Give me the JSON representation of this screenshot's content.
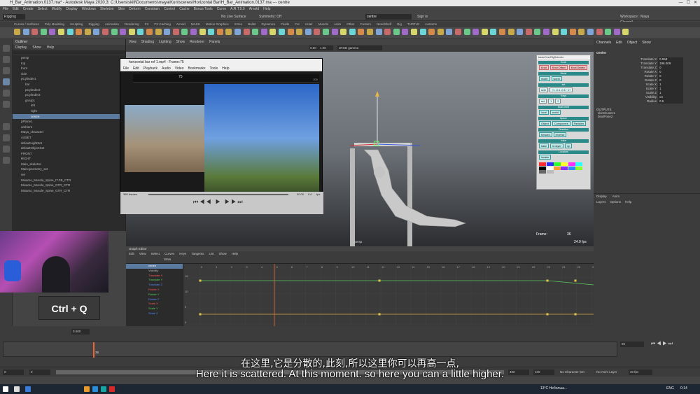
{
  "window": {
    "title": "H_Bar_Animation.0137.ma* - Autodesk Maya 2020.3: C:\\Users\\skill\\Documents\\maya\\Kun\\scenes\\Horizontal Bar\\H_Bar_Animation.0137.ma --- centre"
  },
  "menubar": [
    "File",
    "Edit",
    "Create",
    "Select",
    "Modify",
    "Display",
    "Windows",
    "Skeleton",
    "Skin",
    "Deform",
    "Constrain",
    "Control",
    "Cache",
    "Bonus Tools",
    "Curve",
    "A.R.T.5.0",
    "Arnold",
    "Help"
  ],
  "statusline": {
    "mode": "Rigging",
    "search": "centre",
    "no_live_surface": "No Live Surface",
    "symmetry": "Symmetry: Off",
    "sign_in": "Sign in",
    "workspace": "Workspace : Maya Classic*"
  },
  "shelf_tabs": [
    "Curves / Surfaces",
    "Poly Modeling",
    "Sculpting",
    "Rigging",
    "Animation",
    "Rendering",
    "FX",
    "FX Caching",
    "Arnold",
    "MASH",
    "Motion Graphics",
    "XGen",
    "Bullet",
    "Dynamics",
    "Fluids",
    "Fur",
    "nHair",
    "Muscle",
    "Anim",
    "Other",
    "Custom",
    "NeedShelf",
    "Rig",
    "TURTLE",
    "customs"
  ],
  "outliner": {
    "title": "Outliner",
    "menu": [
      "Display",
      "Show",
      "Help"
    ],
    "items": [
      {
        "label": "persp",
        "sel": false
      },
      {
        "label": "top",
        "sel": false
      },
      {
        "label": "front",
        "sel": false
      },
      {
        "label": "side",
        "sel": false
      },
      {
        "label": "pCylinder1",
        "sel": false
      },
      {
        "label": "bar",
        "sel": false
      },
      {
        "label": "pCylinder2",
        "sel": false
      },
      {
        "label": "pCylinder3",
        "sel": false
      },
      {
        "label": "group1",
        "sel": false
      },
      {
        "label": "left",
        "sel": false
      },
      {
        "label": "right",
        "sel": false
      },
      {
        "label": "centre",
        "sel": true
      },
      {
        "label": "pPlane1",
        "sel": false
      },
      {
        "label": "ambient",
        "sel": false
      },
      {
        "label": "Maya_character",
        "sel": false
      },
      {
        "label": "ASSET",
        "sel": false
      },
      {
        "label": "defaultLightSet",
        "sel": false
      },
      {
        "label": "defaultObjectSet",
        "sel": false
      },
      {
        "label": "FRONT",
        "sel": false
      },
      {
        "label": "RIGHT",
        "sel": false
      },
      {
        "label": "Main_skeleton",
        "sel": false
      },
      {
        "label": "Main:geometry_set",
        "sel": false
      },
      {
        "label": "set",
        "sel": false
      },
      {
        "label": "Mixamo_Muscle_Spine_IT.FB_CTR",
        "sel": false
      },
      {
        "label": "Mixamo_Muscle_Spine_GTR_CTR",
        "sel": false
      },
      {
        "label": "Mixamo_Muscle_Spine_GTR_CTR",
        "sel": false
      }
    ]
  },
  "viewport": {
    "menu": [
      "View",
      "Shading",
      "Lighting",
      "Show",
      "Renderer",
      "Panels"
    ],
    "color_space": "sRGB gamma",
    "field1": "0.00",
    "field2": "1.00",
    "camera_label": "persp",
    "frame_label": "Frame:",
    "frame_value": "36",
    "fps_value": "24.0 fps"
  },
  "hud": {
    "title": "basicOverRigSelectio",
    "sections": [
      {
        "head": "Knob",
        "buttons": [
          {
            "t": "Knot",
            "c": "red"
          },
          {
            "t": "Knot Offset",
            "c": "red"
          },
          {
            "t": "Knot Delete",
            "c": "red"
          }
        ]
      },
      {
        "head": "Mode",
        "buttons": [
          {
            "t": "mode",
            "c": "teal"
          },
          {
            "t": "world",
            "c": "teal"
          }
        ]
      },
      {
        "head": "set",
        "buttons": [
          {
            "t": "sete",
            "c": "cyan"
          },
          {
            "t": "+1 -0.1 -0.1+ 1+",
            "c": "cyan"
          }
        ]
      },
      {
        "head": "Keys",
        "buttons": [
          {
            "t": "set",
            "c": "cyan"
          },
          {
            "t": "1",
            "c": "cyan"
          },
          {
            "t": "2",
            "c": "cyan"
          }
        ]
      },
      {
        "head": "local world",
        "buttons": [
          {
            "t": "local",
            "c": "teal"
          },
          {
            "t": "world",
            "c": "teal"
          }
        ]
      },
      {
        "head": "Space",
        "buttons": [
          {
            "t": "Object",
            "c": "teal"
          },
          {
            "t": "Component",
            "c": "teal"
          },
          {
            "t": "Particles",
            "c": "teal"
          }
        ]
      },
      {
        "head": "Direction",
        "buttons": [
          {
            "t": "forward",
            "c": "teal"
          },
          {
            "t": "reverse",
            "c": "teal"
          }
        ]
      },
      {
        "head": "bake",
        "buttons": [
          {
            "t": "bake",
            "c": "teal"
          },
          {
            "t": "to layer",
            "c": "teal"
          },
          {
            "t": "np",
            "c": "teal"
          }
        ]
      },
      {
        "head": "Locators",
        "buttons": [
          {
            "t": "locator",
            "c": "teal"
          }
        ]
      }
    ],
    "swatches": [
      "#ff2d2d",
      "#2d2dff",
      "#2dff2d",
      "#ffff2d",
      "#ff2dff",
      "#2dffff",
      "#000000",
      "#ffffff",
      "#ff9a2d",
      "#8a2dff",
      "#2d8aff",
      "#8aff2d",
      "#666666",
      "#bbbbbb"
    ]
  },
  "video_player": {
    "title": "horizontal bar ref 1.mp4 - Frame:75",
    "menu": [
      "File",
      "Edit",
      "Playback",
      "Audio",
      "Video",
      "Bookmarks",
      "Tools",
      "Help"
    ],
    "ruler_frame": "75",
    "ruler_end": "200",
    "frame_overlay": "75",
    "frames_label": "360 frames",
    "fps_label": "30.00",
    "rate_label": "0.0",
    "fps_unit": "fps"
  },
  "channelbox": {
    "menu": [
      "Channels",
      "Edit",
      "Object",
      "Show"
    ],
    "object": "centre",
    "attributes": [
      {
        "name": "Translate X",
        "value": "0.558"
      },
      {
        "name": "Translate Y",
        "value": "196.009"
      },
      {
        "name": "Translate Z",
        "value": "0"
      },
      {
        "name": "Rotate X",
        "value": "0"
      },
      {
        "name": "Rotate Y",
        "value": "0"
      },
      {
        "name": "Rotate Z",
        "value": "0"
      },
      {
        "name": "Scale X",
        "value": "1"
      },
      {
        "name": "Scale Y",
        "value": "1"
      },
      {
        "name": "Scale Z",
        "value": "1"
      },
      {
        "name": "Visibility",
        "value": "on"
      },
      {
        "name": "Radius",
        "value": "0.5"
      }
    ],
    "outputs_label": "OUTPUTS",
    "outputs": [
      "skinCluster1",
      "bindPose2"
    ]
  },
  "layerbox": {
    "tabs": [
      "Display",
      "Anim"
    ],
    "menu": [
      "Layers",
      "Options",
      "Help"
    ]
  },
  "graph_editor": {
    "title": "Graph Editor",
    "menu": [
      "Edit",
      "View",
      "Select",
      "Curves",
      "Keys",
      "Tangents",
      "List",
      "Show",
      "Help"
    ],
    "stats_label": "Stats",
    "channels": [
      {
        "label": "centre",
        "color": "#ffffff",
        "sel": true
      },
      {
        "label": "Visibility",
        "color": "#bbbbbb",
        "sel": false
      },
      {
        "label": "Translate X",
        "color": "#ff5555",
        "sel": false
      },
      {
        "label": "Translate Y",
        "color": "#55cc55",
        "sel": false
      },
      {
        "label": "Translate Z",
        "color": "#5588ff",
        "sel": false
      },
      {
        "label": "Rotate X",
        "color": "#ff5555",
        "sel": false
      },
      {
        "label": "Rotate Y",
        "color": "#55cc55",
        "sel": false
      },
      {
        "label": "Rotate Z",
        "color": "#5588ff",
        "sel": false
      },
      {
        "label": "Scale X",
        "color": "#ff5555",
        "sel": false
      },
      {
        "label": "Scale Y",
        "color": "#55cc55",
        "sel": false
      },
      {
        "label": "Scale Z",
        "color": "#5588ff",
        "sel": false
      }
    ],
    "y_ticks": [
      "15",
      "10",
      "5",
      "0"
    ],
    "x_ticks": [
      "0",
      "1",
      "2",
      "3",
      "4",
      "5",
      "6",
      "7",
      "8",
      "9",
      "10",
      "11",
      "12",
      "13",
      "14",
      "15",
      "16",
      "17",
      "18",
      "19",
      "20",
      "21",
      "22",
      "23",
      "24",
      "25",
      "26"
    ]
  },
  "timeslider": {
    "current_frame": "36",
    "end_value": "96",
    "field": "0.500",
    "range_start": "0",
    "range_inner_start": "0",
    "range_end": "400",
    "range_inner_end": "400",
    "character_set": "No Character Set",
    "anim_layer": "No Anim Layer",
    "fps": "30 fps"
  },
  "webcam_overlay": {
    "keystroke": "Ctrl + Q"
  },
  "subtitles": {
    "chinese": "在这里,它是分散的,此刻,所以这里你可以再高一点,",
    "english": "Here it is scattered. At this moment. so here you can a little higher."
  },
  "taskbar": {
    "weather": "13°C  Небольш...",
    "lang": "ENG",
    "time": "0:14"
  }
}
